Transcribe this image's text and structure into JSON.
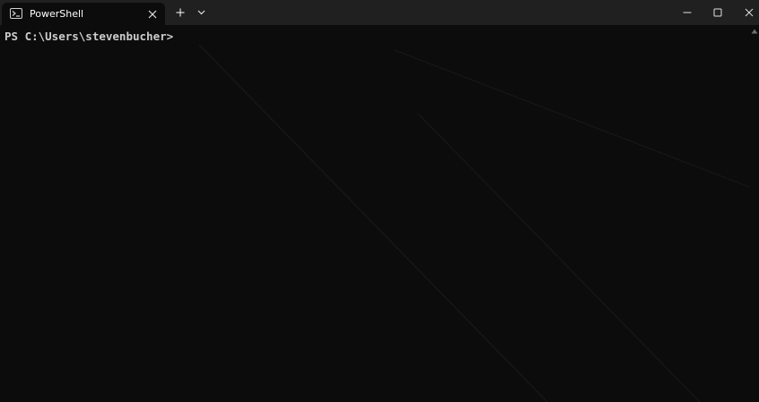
{
  "app": {
    "tab_title": "PowerShell"
  },
  "titlebar": {
    "new_tab_symbol": "+",
    "dropdown_icon": "chevron-down-icon",
    "minimize_icon": "minimize-icon",
    "maximize_icon": "maximize-icon",
    "close_icon": "close-icon"
  },
  "terminal": {
    "prompt": "PS C:\\Users\\stevenbucher>"
  },
  "colors": {
    "titlebar_bg": "#202020",
    "terminal_bg": "#0c0c0c",
    "text": "#cccccc"
  }
}
